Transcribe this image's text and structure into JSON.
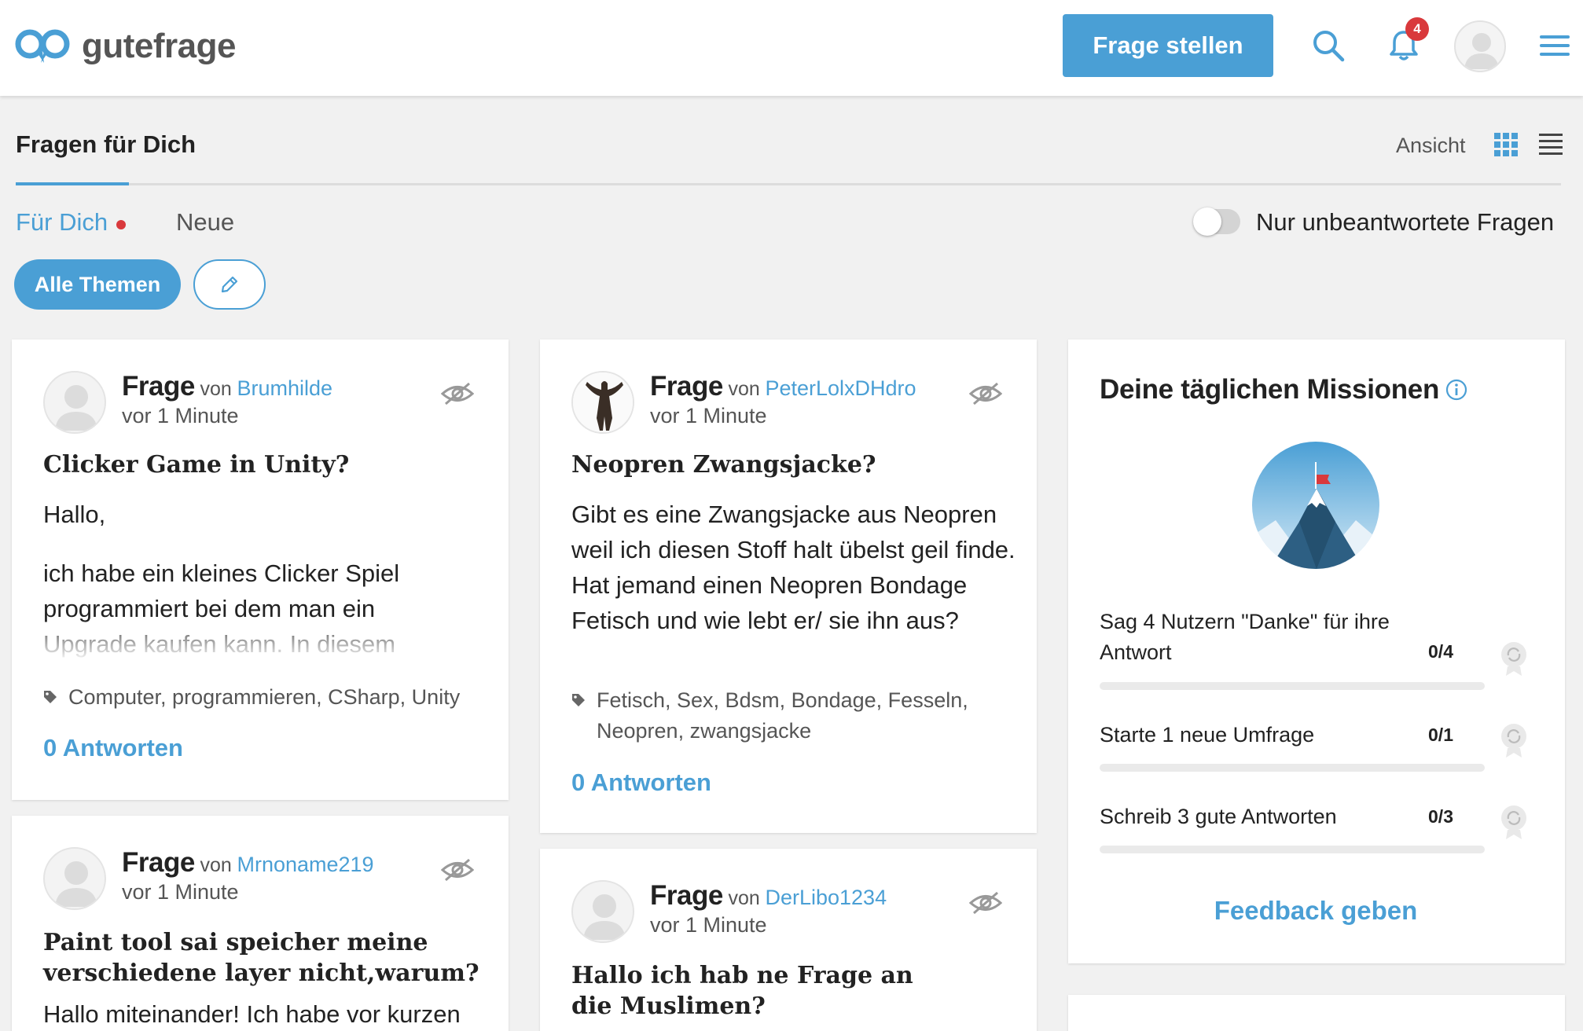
{
  "header": {
    "brand": "gutefrage",
    "ask_button": "Frage stellen",
    "notification_count": "4",
    "accent_color": "#4a9fd5"
  },
  "page": {
    "title": "Fragen für Dich",
    "view_label": "Ansicht",
    "tabs": [
      "Für Dich",
      "Neue"
    ],
    "toggle_label": "Nur unbeantwortete Fragen",
    "toggle_on": false,
    "filter_all": "Alle Themen"
  },
  "cards": [
    {
      "label": "Frage",
      "von": "von",
      "user": "Brumhilde",
      "time": "vor 1 Minute",
      "title": "Clicker Game in Unity?",
      "body1": "Hallo,",
      "body2": "ich habe ein kleines Clicker Spiel programmiert bei dem man ein Upgrade kaufen kann. In diesem",
      "tags": "Computer, programmieren, CSharp, Unity",
      "answers": "0 Antworten"
    },
    {
      "label": "Frage",
      "von": "von",
      "user": "PeterLolxDHdro",
      "time": "vor 1 Minute",
      "title": "Neopren Zwangsjacke?",
      "body": "Gibt es eine Zwangsjacke aus Neopren weil ich diesen Stoff halt übelst geil finde. Hat jemand einen Neopren Bondage Fetisch und wie lebt er/ sie ihn aus?",
      "tags": "Fetisch, Sex, Bdsm, Bondage, Fesseln, Neopren, zwangsjacke",
      "answers": "0 Antworten"
    },
    {
      "label": "Frage",
      "von": "von",
      "user": "Mrnoname219",
      "time": "vor 1 Minute",
      "title": "Paint tool sai speicher meine verschiedene layer nicht,warum?",
      "body": "Hallo miteinander! Ich habe vor kurzen"
    },
    {
      "label": "Frage",
      "von": "von",
      "user": "DerLibo1234",
      "time": "vor 1 Minute",
      "title": "Hallo ich hab ne Frage an die Muslimen?"
    }
  ],
  "missions": {
    "title": "Deine täglichen Missionen",
    "items": [
      {
        "text": "Sag 4 Nutzern \"Danke\" für ihre Antwort",
        "count": "0/4",
        "progress": 0
      },
      {
        "text": "Starte 1 neue Umfrage",
        "count": "0/1",
        "progress": 0
      },
      {
        "text": "Schreib 3 gute Antworten",
        "count": "0/3",
        "progress": 0
      }
    ],
    "feedback": "Feedback geben"
  }
}
